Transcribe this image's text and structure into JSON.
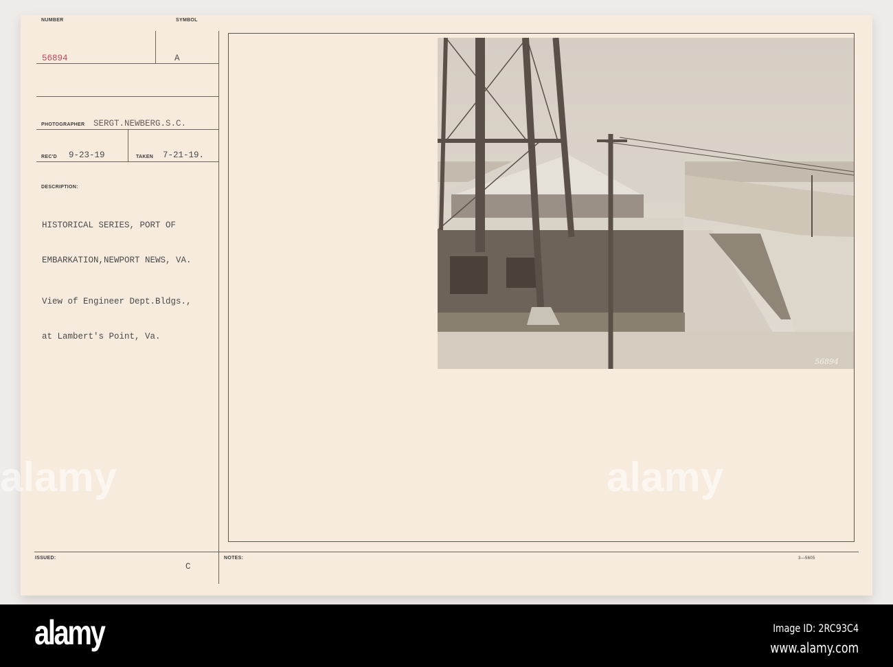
{
  "card": {
    "number_label": "NUMBER",
    "number_value": "56894",
    "symbol_label": "SYMBOL",
    "symbol_value": "A",
    "photographer_label": "PHOTOGRAPHER",
    "photographer_value": "SERGT.NEWBERG.S.C.",
    "recd_label": "REC'D",
    "recd_value": "9-23-19",
    "taken_label": "TAKEN",
    "taken_value": "7-21-19.",
    "description_label": "DESCRIPTION:",
    "description_lines": [
      "HISTORICAL SERIES, PORT OF",
      "EMBARKATION,NEWPORT NEWS, VA."
    ],
    "caption_lines": [
      "View of Engineer Dept.Bldgs.,",
      "at Lambert's Point, Va."
    ],
    "issued_label": "ISSUED:",
    "issued_mark": "C",
    "notes_label": "NOTES:",
    "form_number": "3—5605",
    "photo_number": "56894"
  },
  "footer": {
    "logo": "alamy",
    "image_id": "Image ID: 2RC93C4",
    "website": "www.alamy.com"
  },
  "colors": {
    "card": "#f6ebdd",
    "red_ink": "#c2475a",
    "band": "#000000"
  }
}
